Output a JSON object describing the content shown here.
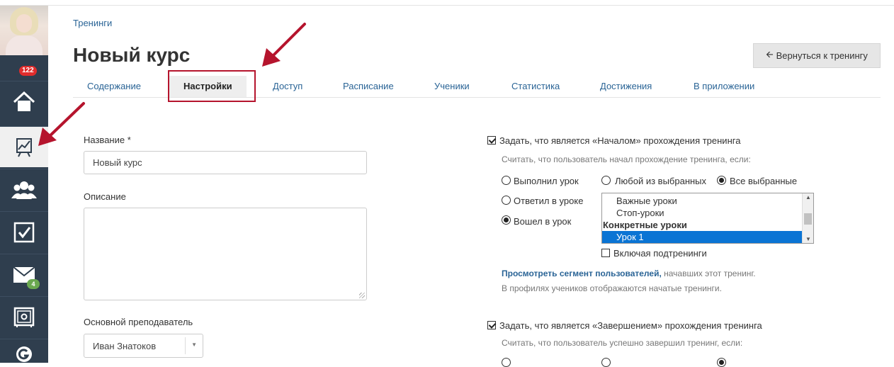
{
  "sidebar": {
    "notifications_count": "122",
    "messages_count": "4"
  },
  "header": {
    "breadcrumb": "Тренинги",
    "title": "Новый курс",
    "back_button": "Вернуться к тренингу"
  },
  "tabs": [
    {
      "label": "Содержание"
    },
    {
      "label": "Настройки"
    },
    {
      "label": "Доступ"
    },
    {
      "label": "Расписание"
    },
    {
      "label": "Ученики"
    },
    {
      "label": "Статистика"
    },
    {
      "label": "Достижения"
    },
    {
      "label": "В приложении"
    }
  ],
  "form": {
    "name_label": "Название *",
    "name_value": "Новый курс",
    "description_label": "Описание",
    "teacher_label": "Основной преподаватель",
    "teacher_value": "Иван Знатоков"
  },
  "start": {
    "checkbox_label": "Задать, что является «Началом» прохождения тренинга",
    "hint": "Считать, что пользователь начал прохождение тренинга, если:",
    "radio_lesson_done": "Выполнил урок",
    "radio_answered": "Ответил в уроке",
    "radio_entered": "Вошел в урок",
    "radio_any": "Любой из выбранных",
    "radio_all": "Все выбранные",
    "list_options": [
      {
        "label": "Важные уроки"
      },
      {
        "label": "Стоп-уроки"
      },
      {
        "label": "Конкретные уроки"
      },
      {
        "label": "Урок 1"
      }
    ],
    "include_sub": "Включая подтренинги",
    "segment_link": "Просмотреть сегмент пользователей,",
    "segment_rest": " начавших этот тренинг.",
    "profiles_note": "В профилях учеников отображаются начатые тренинги."
  },
  "finish": {
    "checkbox_label": "Задать, что является «Завершением» прохождения тренинга",
    "hint": "Считать, что пользователь успешно завершил тренинг, если:"
  },
  "colors": {
    "sidebar": "#2f3e4e",
    "link": "#2a6496",
    "annotation_red": "#b5142d",
    "selected_option": "#0a74d4"
  }
}
